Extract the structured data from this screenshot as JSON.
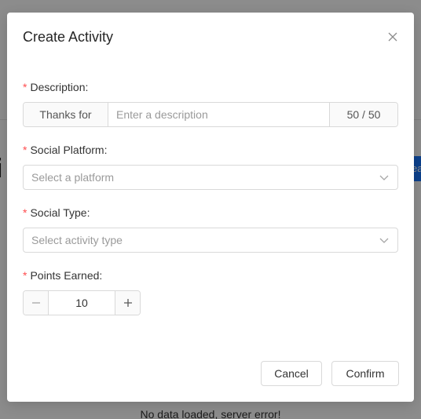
{
  "background": {
    "error_text": "No data loaded, server error!",
    "title_fragment": "i",
    "button_fragment": "ea"
  },
  "modal": {
    "title": "Create Activity",
    "fields": {
      "description": {
        "label": "Description:",
        "prefix": "Thanks for",
        "placeholder": "Enter a description",
        "value": "",
        "counter": "50 / 50"
      },
      "platform": {
        "label": "Social Platform:",
        "placeholder": "Select a platform"
      },
      "type": {
        "label": "Social Type:",
        "placeholder": "Select activity type"
      },
      "points": {
        "label": "Points Earned:",
        "value": "10"
      }
    },
    "required_marker": "*",
    "buttons": {
      "cancel": "Cancel",
      "confirm": "Confirm"
    }
  },
  "colors": {
    "required": "#ff4d4f",
    "primary": "#1677ff",
    "border": "#d9d9d9"
  },
  "icons": [
    "close-icon",
    "chevron-down-icon",
    "minus-icon",
    "plus-icon"
  ]
}
